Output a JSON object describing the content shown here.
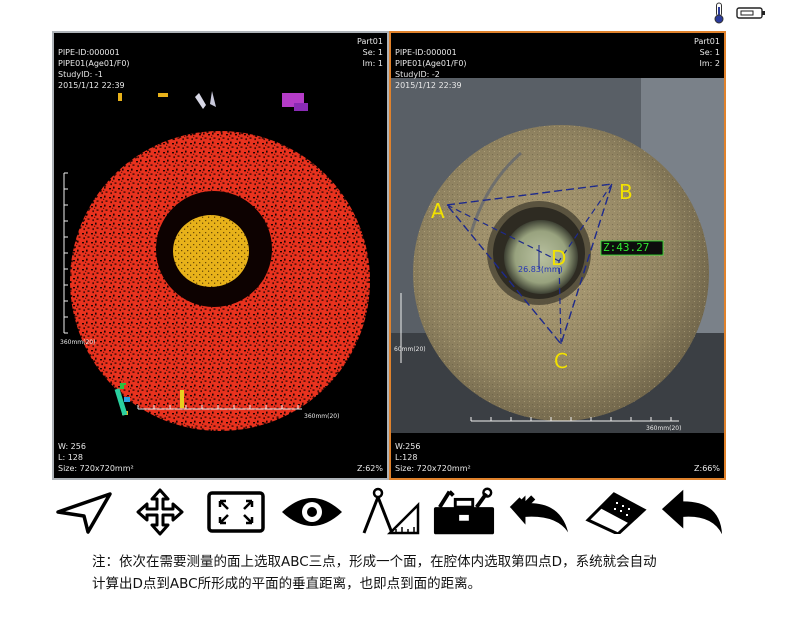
{
  "status": {
    "icons": [
      "thermometer-icon",
      "battery-icon"
    ]
  },
  "left_view": {
    "part": "Part01",
    "patient_id": "PIPE-ID:000001",
    "patient_name": "PIPE01(Age01/F0)",
    "study_id": "StudyID: -1",
    "datetime": "2015/1/12 22:39",
    "series": "Se: 1",
    "image": "Im: 1",
    "window_w": "W: 256",
    "window_l": "L: 128",
    "size": "Size: 720x720mm²",
    "zoom": "Z:62%",
    "vscale_label": "360mm(20)",
    "hscale_label": "360mm(20)"
  },
  "right_view": {
    "part": "Part01",
    "patient_id": "PIPE-ID:000001",
    "patient_name": "PIPE01(Age01/F0)",
    "study_id": "StudyID: -2",
    "datetime": "2015/1/12 22:39",
    "series": "Se: 1",
    "image": "Im: 2",
    "window_w": "W:256",
    "window_l": "L:128",
    "size": "Size: 720x720mm²",
    "zoom": "Z:66%",
    "vscale_label": "60mm(20)",
    "hscale_label": "360mm(20)",
    "point_a": "A",
    "point_b": "B",
    "point_c": "C",
    "point_d": "D",
    "distance_label": "26.83(mm)",
    "z_value": "Z:43.27"
  },
  "toolbar": {
    "tools": [
      "pointer-icon",
      "pan-arrows-icon",
      "fit-screen-icon",
      "eye-icon",
      "measure-compass-icon",
      "toolbox-icon",
      "undo-all-icon",
      "eraser-icon",
      "undo-icon"
    ]
  },
  "note": {
    "line1": "注：依次在需要测量的面上选取ABC三点，形成一个面，在腔体内选取第四点D，系统就会自动",
    "line2": "计算出D点到ABC所形成的平面的垂直距离，也即点到面的距离。"
  },
  "colors": {
    "accent": "#e0822c",
    "overlay_text": "#e8e8e8",
    "measure_line": "#1e2a8c",
    "point_label": "#f2e200",
    "z_box_text": "#2ee82e"
  }
}
